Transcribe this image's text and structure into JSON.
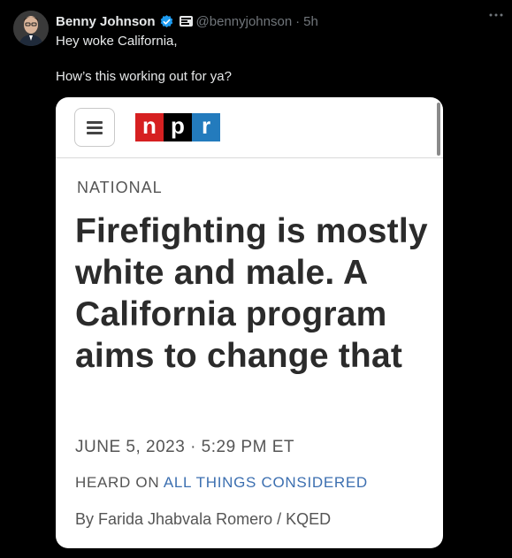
{
  "tweet": {
    "display_name": "Benny Johnson",
    "handle": "@bennyjohnson",
    "separator": "·",
    "time": "5h",
    "text_line1": "Hey woke California,",
    "text_line2": "How’s this working out for ya?",
    "icons": {
      "verified": "verified-badge-icon",
      "affiliate": "affiliate-badge-icon",
      "more": "more-options-icon"
    },
    "colors": {
      "background": "#000000",
      "verified": "#1d9bf0",
      "secondary_text": "#71767b"
    }
  },
  "article_card": {
    "logo_letters": [
      "n",
      "p",
      "r"
    ],
    "logo_colors": [
      "#d62021",
      "#000000",
      "#237bbd"
    ],
    "section": "NATIONAL",
    "headline": "Firefighting is mostly white and male. A California program aims to change that",
    "date": "JUNE 5, 2023 · 5:29 PM ET",
    "heard_on_prefix": "HEARD ON",
    "heard_on_show": "ALL THINGS CONSIDERED",
    "byline": "By Farida Jhabvala Romero / KQED",
    "icons": {
      "menu": "hamburger-menu-icon"
    }
  }
}
